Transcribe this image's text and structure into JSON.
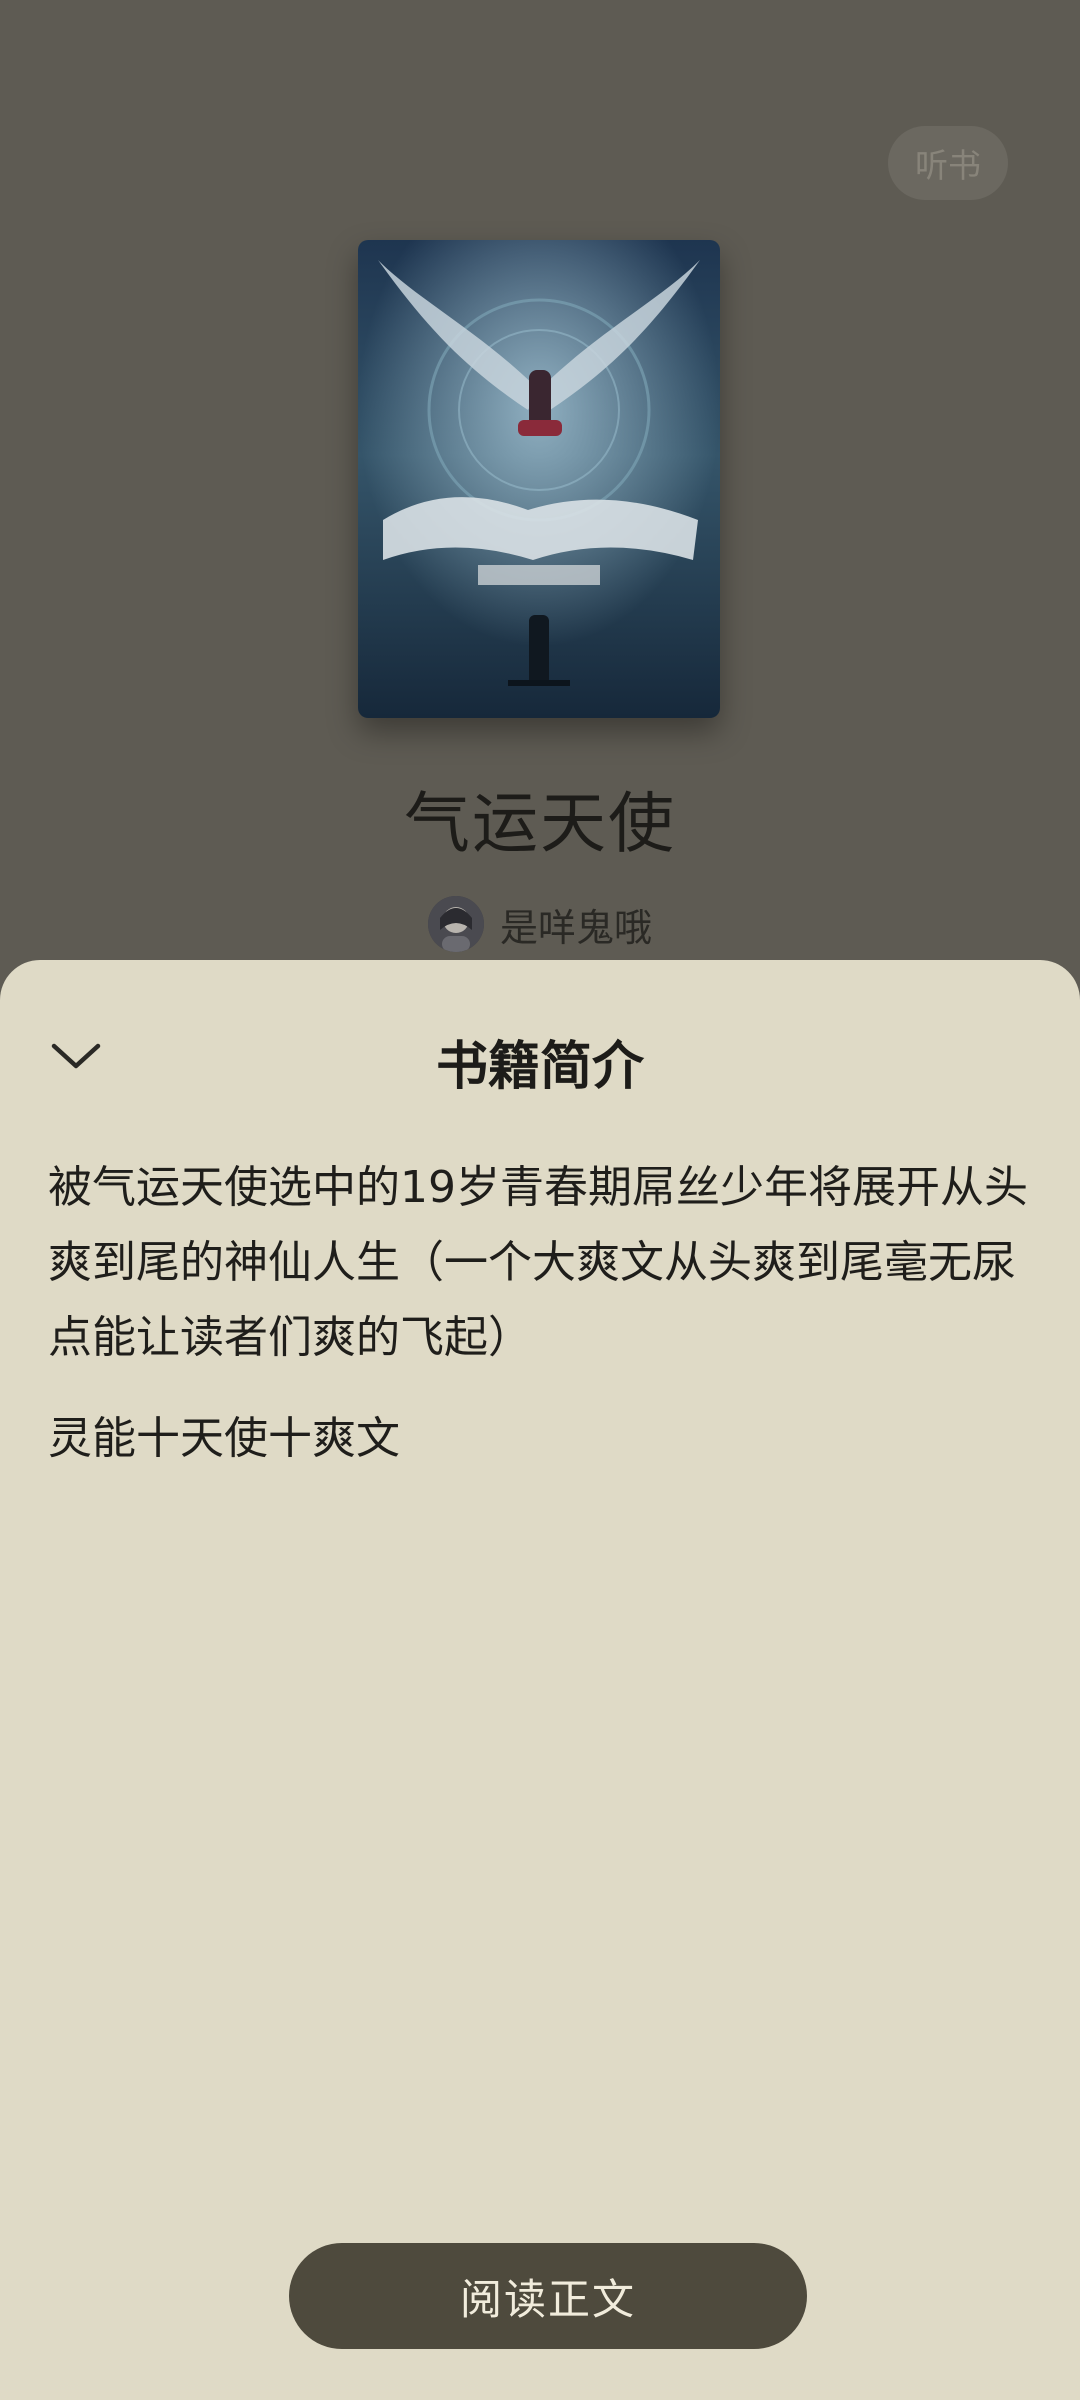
{
  "header": {
    "listen_label": "听书"
  },
  "book": {
    "title": "气运天使",
    "author": "是咩鬼哦"
  },
  "intro_sheet": {
    "title": "书籍简介",
    "paragraphs": [
      "被气运天使选中的19岁青春期屌丝少年将展开从头爽到尾的神仙人生（一个大爽文从头爽到尾毫无尿点能让读者们爽的飞起）",
      "灵能十天使十爽文"
    ],
    "read_label": "阅读正文"
  },
  "colors": {
    "overlay": "#5e5b53",
    "sheet": "#dfdac6",
    "read_button": "#4e4a3d"
  }
}
